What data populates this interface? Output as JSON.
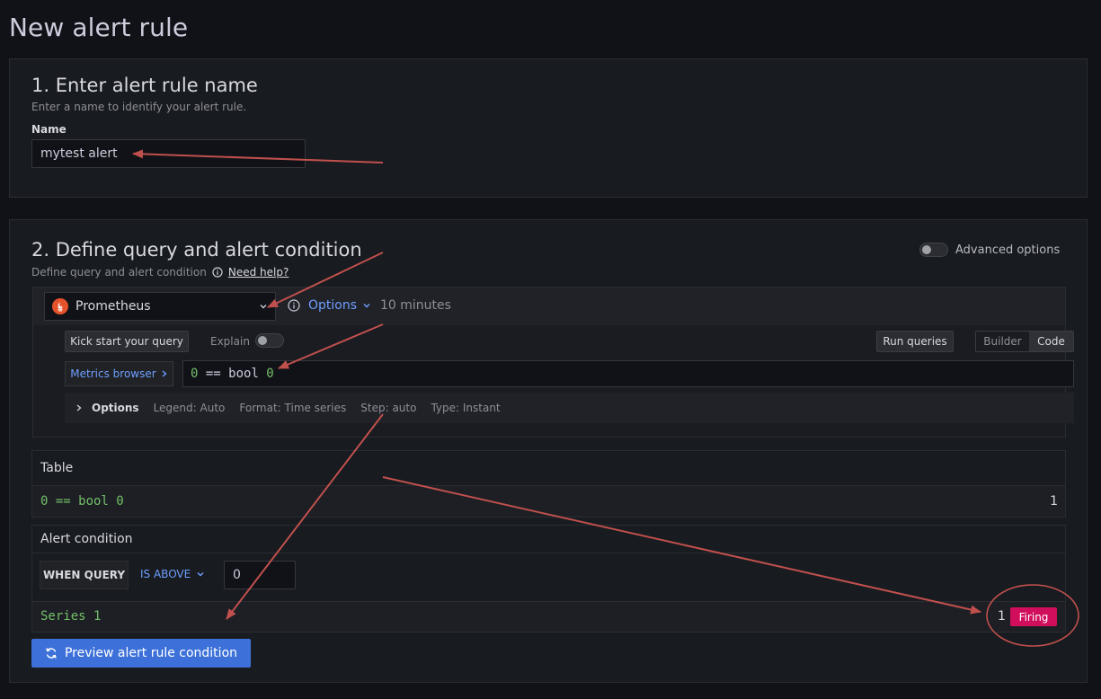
{
  "page": {
    "title": "New alert rule"
  },
  "section1": {
    "title": "1. Enter alert rule name",
    "description": "Enter a name to identify your alert rule.",
    "name_label": "Name",
    "name_value": "mytest alert"
  },
  "section2": {
    "title": "2. Define query and alert condition",
    "description": "Define query and alert condition",
    "help_link": "Need help?",
    "advanced_options": "Advanced options",
    "query": {
      "datasource": "Prometheus",
      "options_label": "Options",
      "time_range": "10 minutes",
      "kick_start": "Kick start your query",
      "explain": "Explain",
      "run_queries": "Run queries",
      "mode_builder": "Builder",
      "mode_code": "Code",
      "metrics_browser": "Metrics browser",
      "expr_a": "0",
      "expr_b": " == bool ",
      "expr_c": "0",
      "options_row": {
        "title": "Options",
        "legend": "Legend: Auto",
        "format": "Format: Time series",
        "step": "Step: auto",
        "type": "Type: Instant"
      }
    },
    "table": {
      "title": "Table",
      "row_label": "0 == bool 0",
      "row_value": "1"
    },
    "alert_condition": {
      "title": "Alert condition",
      "when_query": "WHEN QUERY",
      "operator": "IS ABOVE",
      "threshold": "0",
      "series_label": "Series 1",
      "series_value": "1",
      "state": "Firing"
    },
    "preview_button": "Preview alert rule condition"
  },
  "colors": {
    "background": "#111217",
    "panel": "#181b1f",
    "accent_blue": "#3d71d9",
    "link_blue": "#6e9fff",
    "green_text": "#73bf69",
    "firing": "#d10e5c",
    "annotation_red": "#c0504d"
  },
  "icons": [
    "info-circle-icon",
    "chevron-down-icon",
    "chevron-right-icon",
    "sync-icon",
    "prometheus-logo"
  ]
}
